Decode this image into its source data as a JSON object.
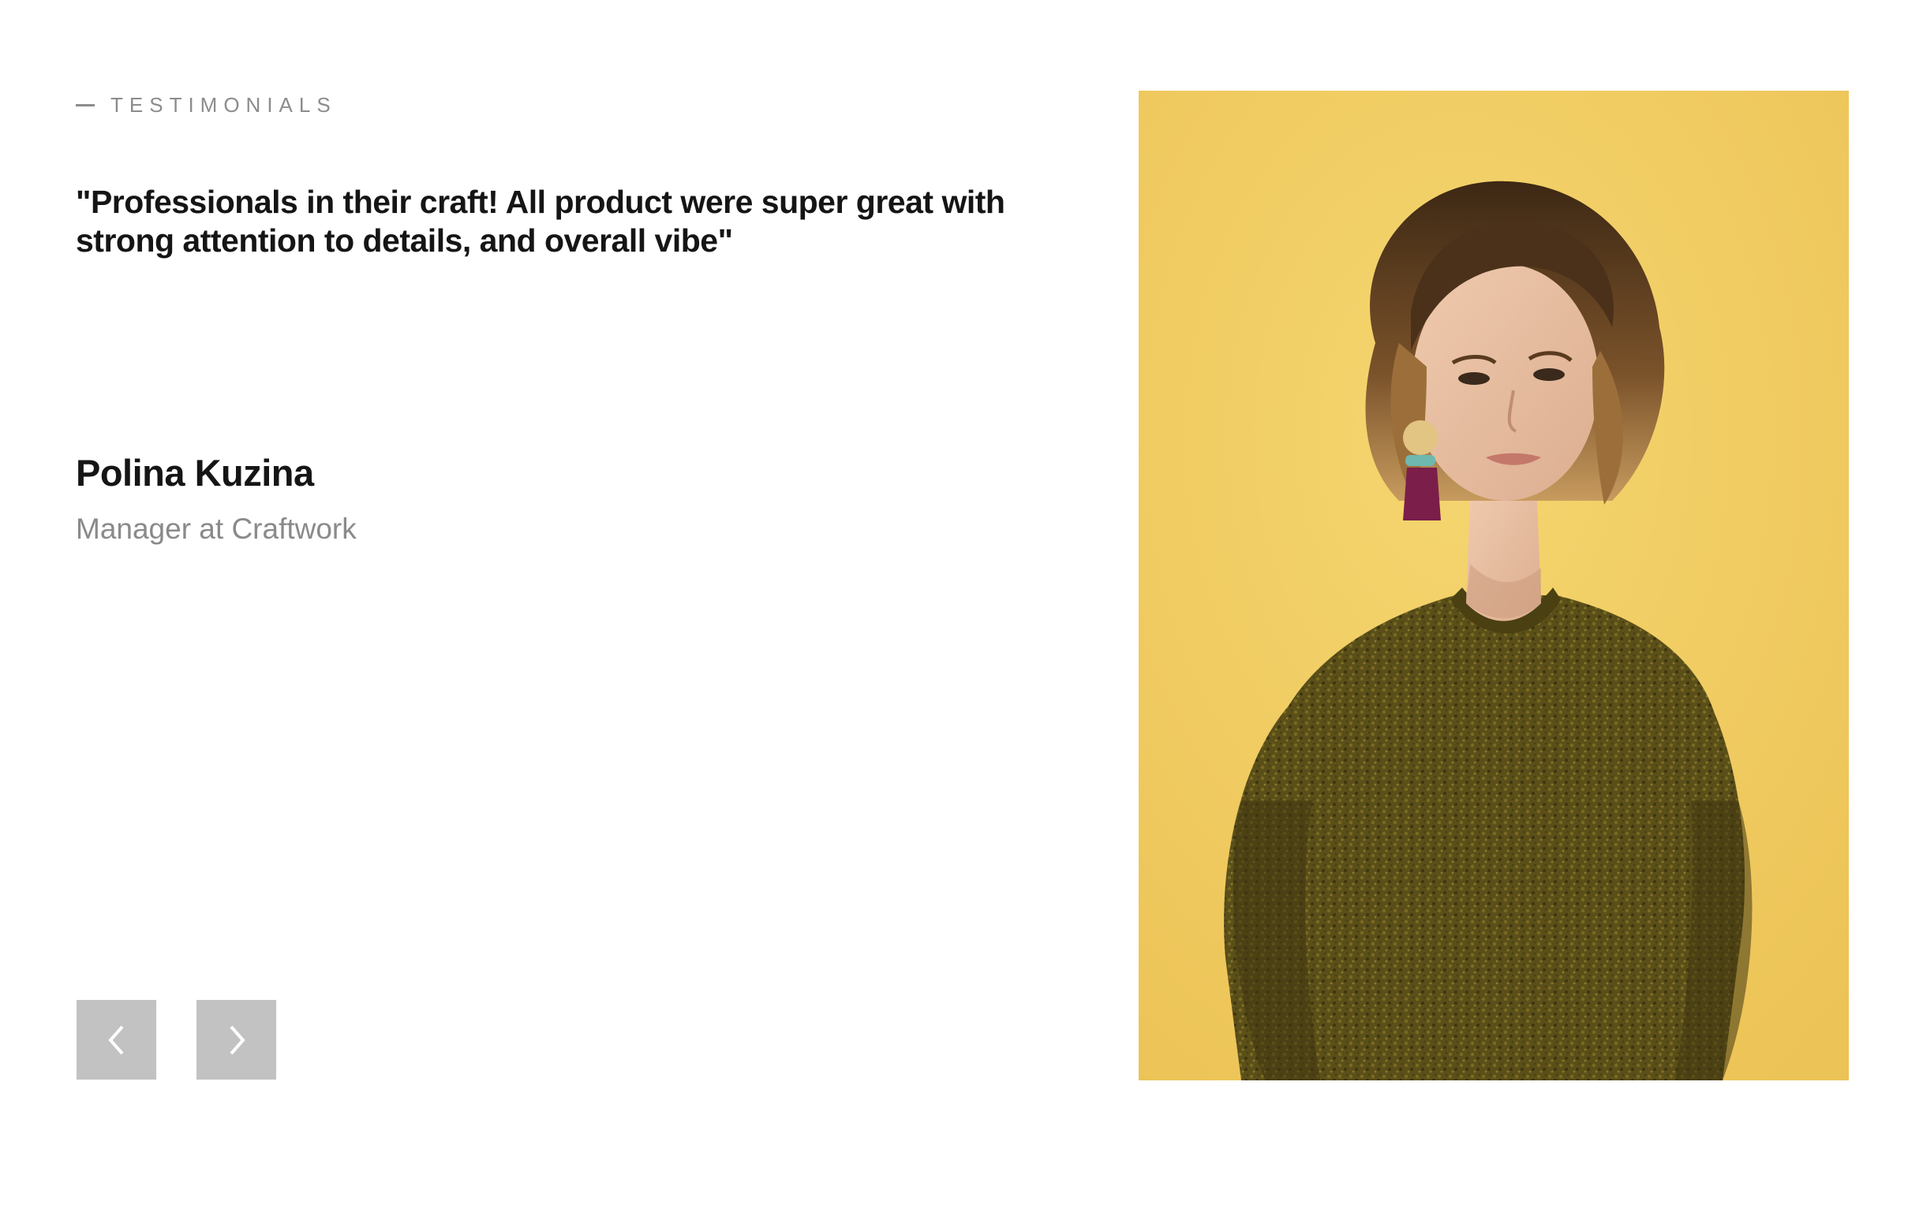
{
  "section": {
    "eyebrow": "TESTIMONIALS"
  },
  "testimonial": {
    "quote": "\"Professionals in their craft! All product were super great with strong attention to details, and overall vibe\"",
    "author_name": "Polina Kuzina",
    "author_role": "Manager at Craftwork"
  },
  "navigation": {
    "prev_icon": "chevron-left-icon",
    "next_icon": "chevron-right-icon"
  },
  "photo": {
    "subject": "portrait-photo",
    "colors": {
      "background": "#f2cc63",
      "sweater": "#5b4f19",
      "hair": "#5a3b1f",
      "skin": "#e8bea1"
    }
  },
  "colors": {
    "text_primary": "#151515",
    "text_secondary": "#8a8a8a",
    "button_bg": "#c2c2c2",
    "photo_bg": "#f2cc63"
  }
}
